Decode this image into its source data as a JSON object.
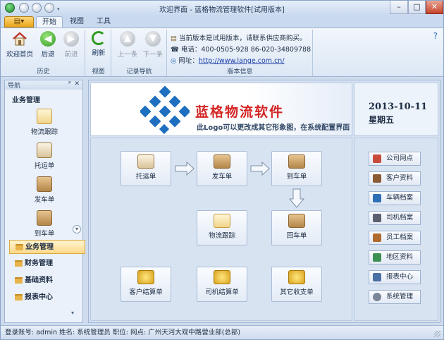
{
  "window": {
    "title": "欢迎界面 - 蓝格物流管理软件[试用版本]"
  },
  "titlebar_controls": {
    "minimize": "–",
    "maximize": "□",
    "close": "✕"
  },
  "ribbon_tabs": [
    "开始",
    "视图",
    "工具"
  ],
  "ribbon_groups": [
    {
      "title": "历史",
      "buttons": [
        {
          "label": "欢迎首页",
          "icon": "home-icon"
        },
        {
          "label": "后退",
          "icon": "back-arrow-icon"
        },
        {
          "label": "前进",
          "icon": "forward-arrow-icon"
        }
      ]
    },
    {
      "title": "视图",
      "buttons": [
        {
          "label": "刷新",
          "icon": "refresh-icon"
        }
      ]
    },
    {
      "title": "记录导航",
      "buttons": [
        {
          "label": "上一条",
          "icon": "up-arrow-icon"
        },
        {
          "label": "下一条",
          "icon": "down-arrow-icon"
        }
      ]
    },
    {
      "title": "版本信息"
    }
  ],
  "version_info": {
    "line1": "当前版本是试用版本，请联系供应商购买。",
    "phone_label": "电话：",
    "phone": "400-0505-928  86-020-34809788",
    "url_label": "网址：",
    "url": "http://www.lange.com.cn/"
  },
  "sidebar": {
    "header": "导航",
    "pin": "ᵖ",
    "close": "✕",
    "section": "业务管理",
    "items": [
      {
        "label": "物流跟踪",
        "icon": "document-pencil-icon"
      },
      {
        "label": "托运单",
        "icon": "clipboard-icon"
      },
      {
        "label": "发车单",
        "icon": "truck-icon"
      },
      {
        "label": "到车单",
        "icon": "truck-arrive-icon"
      }
    ],
    "scroll": "▾",
    "categories": [
      {
        "label": "业务管理",
        "active": true
      },
      {
        "label": "财务管理",
        "active": false
      },
      {
        "label": "基础资料",
        "active": false
      },
      {
        "label": "报表中心",
        "active": false
      }
    ],
    "more": "▾"
  },
  "banner": {
    "logo_text": "蓝格物流软件",
    "note": "此Logo可以更改成其它形象图，在系统配置界面"
  },
  "date_panel": {
    "date": "2013-10-11",
    "weekday": "星期五"
  },
  "flow": {
    "consignment": "托运单",
    "dispatch": "发车单",
    "arrival": "到车单",
    "tracking": "物流跟踪",
    "return": "回车单",
    "customer_settle": "客户结算单",
    "driver_settle": "司机结算单",
    "other_income": "其它收支单"
  },
  "quick_links": [
    {
      "label": "公司网点",
      "color": "#c84a3a"
    },
    {
      "label": "客户资料",
      "color": "#8a5a32"
    },
    {
      "label": "车辆档案",
      "color": "#2f6fb5"
    },
    {
      "label": "司机档案",
      "color": "#5a6070"
    },
    {
      "label": "员工档案",
      "color": "#b06a30"
    },
    {
      "label": "地区资料",
      "color": "#3e8f52"
    },
    {
      "label": "报表中心",
      "color": "#4a6fa5"
    },
    {
      "label": "系统管理",
      "color": "#7b8799"
    }
  ],
  "statusbar": {
    "text": "登录账号: admin  姓名: 系统管理员  职位:   网点: 广州天河大观中路营业部(总部)"
  },
  "colors": {
    "logo_blue": "#1e6fc0",
    "logo_red": "#d42424",
    "ribbon_bg": "#dce7f5"
  }
}
